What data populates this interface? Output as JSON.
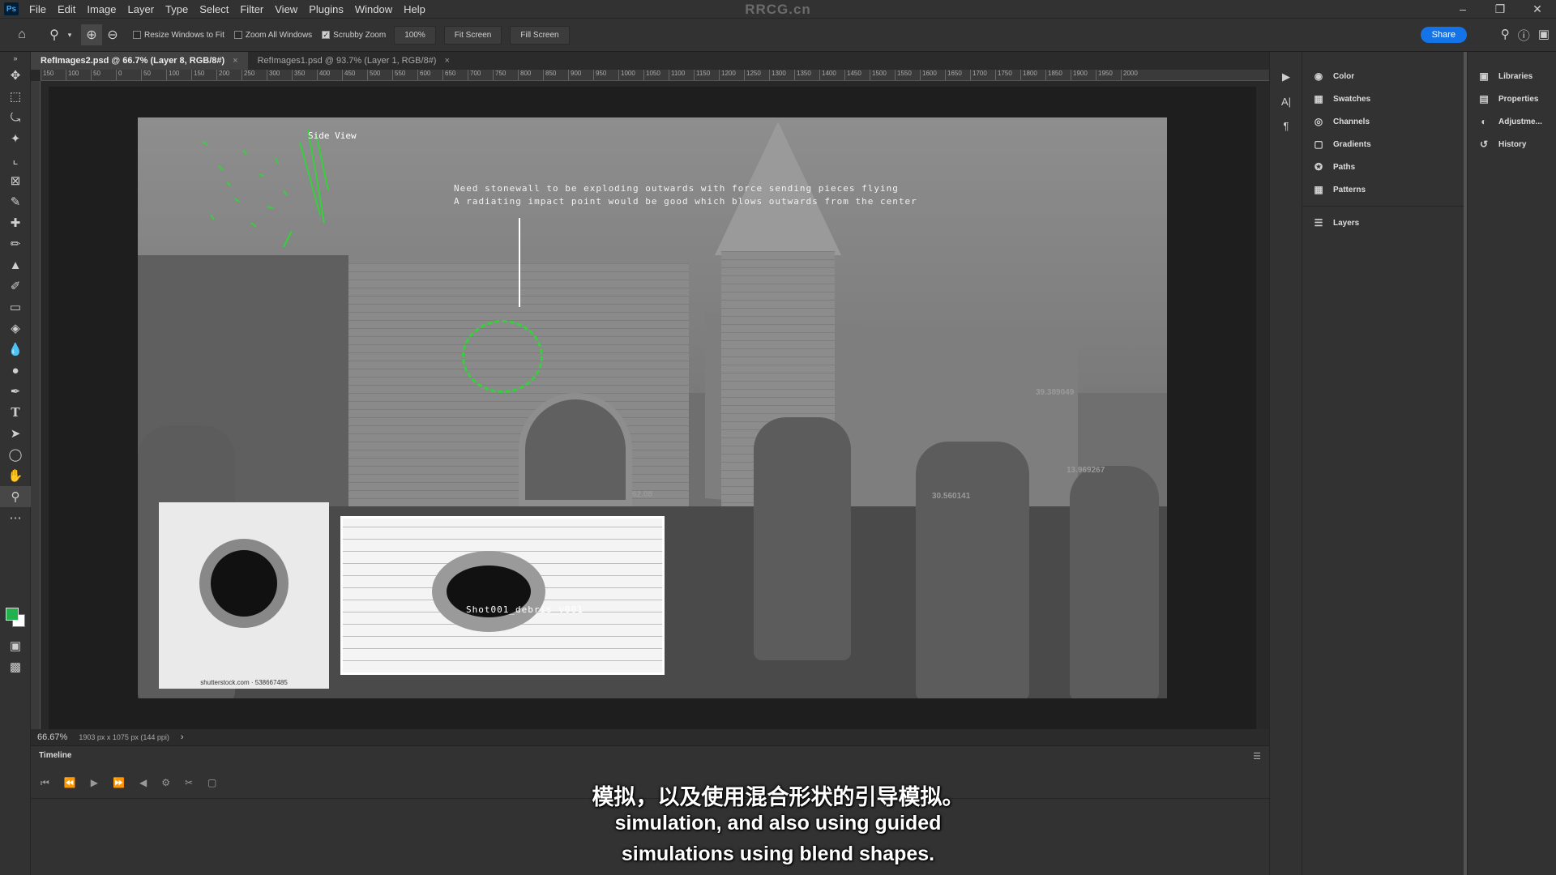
{
  "app": {
    "title_watermark": "RRCG.cn",
    "menu": [
      "File",
      "Edit",
      "Image",
      "Layer",
      "Type",
      "Select",
      "Filter",
      "View",
      "Plugins",
      "Window",
      "Help"
    ]
  },
  "options_bar": {
    "resize_windows": "Resize Windows to Fit",
    "zoom_all": "Zoom All Windows",
    "scrubby_zoom": "Scrubby Zoom",
    "zoom_value": "100%",
    "fit_screen": "Fit Screen",
    "fill_screen": "Fill Screen",
    "share": "Share",
    "resize_checked": false,
    "zoom_all_checked": false,
    "scrubby_checked": true
  },
  "tabs": [
    {
      "label": "RefImages2.psd @ 66.7% (Layer 8, RGB/8#)",
      "active": true
    },
    {
      "label": "RefImages1.psd @ 93.7% (Layer 1, RGB/8#)",
      "active": false
    }
  ],
  "ruler": [
    "150",
    "100",
    "50",
    "0",
    "50",
    "100",
    "150",
    "200",
    "250",
    "300",
    "350",
    "400",
    "450",
    "500",
    "550",
    "600",
    "650",
    "700",
    "750",
    "800",
    "850",
    "900",
    "950",
    "1000",
    "1050",
    "1100",
    "1150",
    "1200",
    "1250",
    "1300",
    "1350",
    "1400",
    "1450",
    "1500",
    "1550",
    "1600",
    "1650",
    "1700",
    "1750",
    "1800",
    "1850",
    "1900",
    "1950",
    "2000"
  ],
  "canvas": {
    "side_view": "Side View",
    "annotation_line1": "Need stonewall to be exploding outwards with force sending pieces flying",
    "annotation_line2": "A radiating impact point would be good which blows outwards from the center",
    "numbers": [
      "39.389049",
      "13.969267",
      "30.560141",
      "62.08"
    ],
    "ref1_credit": "shutterstock.com · 538667485",
    "ref2_label": "Shot001_debris_v001"
  },
  "status": {
    "zoom": "66.67%",
    "doc_info": "1903 px x 1075 px (144 ppi)"
  },
  "timeline": {
    "title": "Timeline"
  },
  "subtitles": {
    "chinese": "模拟，以及使用混合形状的引导模拟。",
    "english_line1": "simulation, and also using guided",
    "english_line2": "simulations using blend shapes."
  },
  "panels": {
    "column1": [
      "Color",
      "Swatches",
      "Channels",
      "Gradients",
      "Paths",
      "Patterns",
      "Layers"
    ],
    "column2": [
      "Libraries",
      "Properties",
      "Adjustme...",
      "History"
    ]
  },
  "colors": {
    "foreground": "#22b14c",
    "background": "#ffffff",
    "accent": "#1473e6"
  }
}
